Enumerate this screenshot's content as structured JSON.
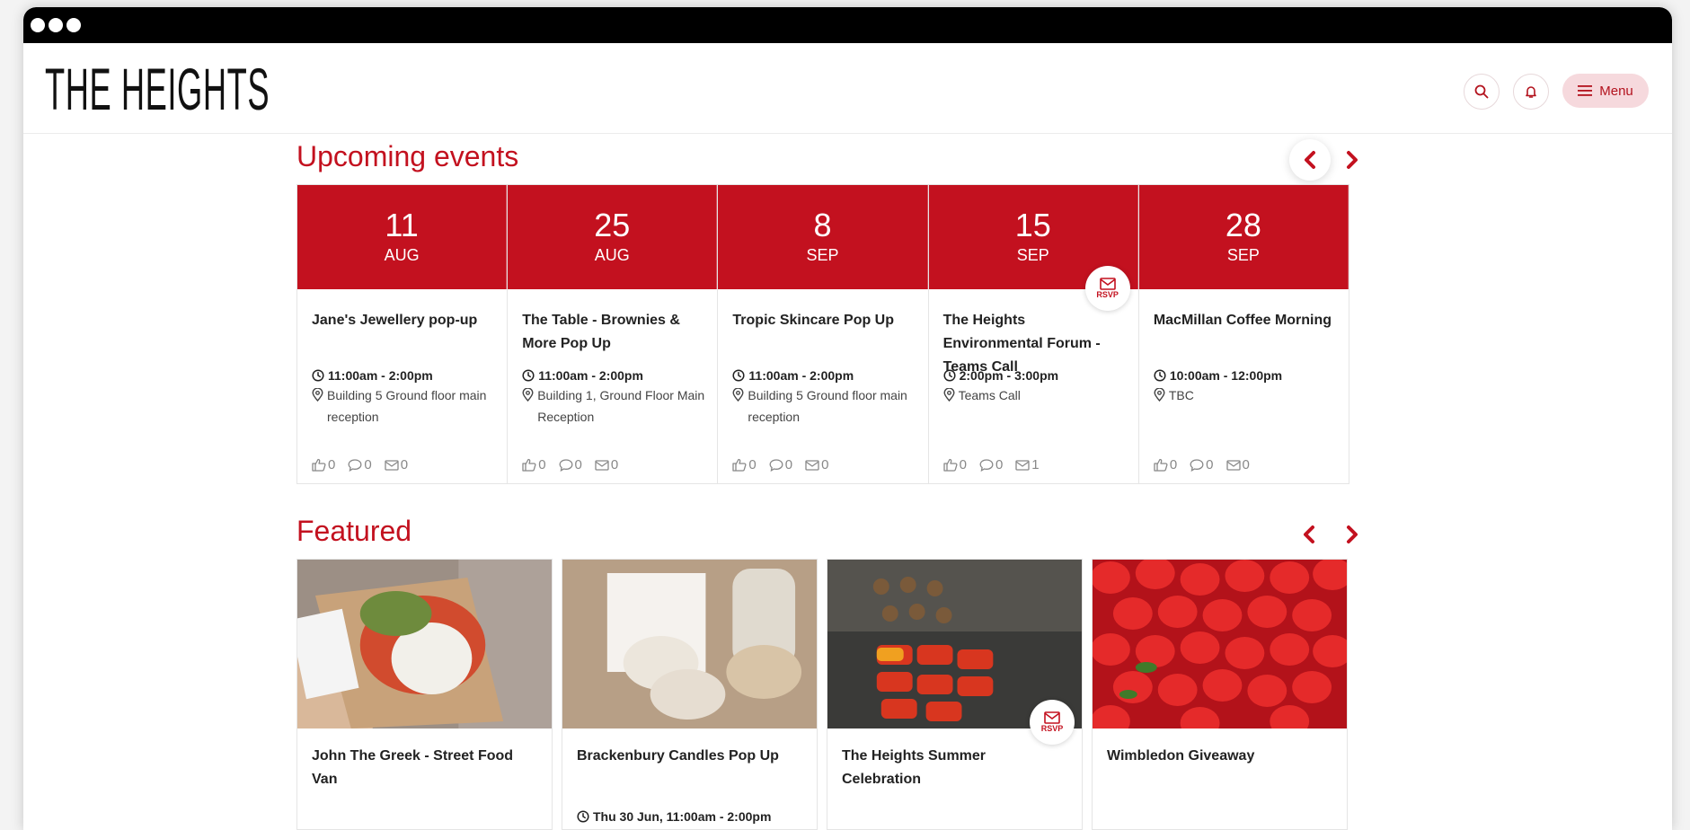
{
  "header": {
    "logo": "THE HEIGHTS",
    "menu_label": "Menu"
  },
  "upcoming": {
    "title": "Upcoming events",
    "events": [
      {
        "day": "11",
        "month": "AUG",
        "title": "Jane's Jewellery pop-up",
        "time": "11:00am - 2:00pm",
        "location": "Building 5 Ground floor main reception",
        "likes": "0",
        "comments": "0",
        "rsvps": "0",
        "rsvp_badge": false
      },
      {
        "day": "25",
        "month": "AUG",
        "title": "The Table - Brownies & More Pop Up",
        "time": "11:00am - 2:00pm",
        "location": "Building 1, Ground Floor Main Reception",
        "likes": "0",
        "comments": "0",
        "rsvps": "0",
        "rsvp_badge": false
      },
      {
        "day": "8",
        "month": "SEP",
        "title": "Tropic Skincare Pop Up",
        "time": "11:00am - 2:00pm",
        "location": "Building 5 Ground floor main reception",
        "likes": "0",
        "comments": "0",
        "rsvps": "0",
        "rsvp_badge": false
      },
      {
        "day": "15",
        "month": "SEP",
        "title": "The Heights Environmental Forum - Teams Call",
        "time": "2:00pm - 3:00pm",
        "location": "Teams Call",
        "likes": "0",
        "comments": "0",
        "rsvps": "1",
        "rsvp_badge": true
      },
      {
        "day": "28",
        "month": "SEP",
        "title": "MacMillan Coffee Morning",
        "time": "10:00am - 12:00pm",
        "location": "TBC",
        "likes": "0",
        "comments": "0",
        "rsvps": "0",
        "rsvp_badge": false
      }
    ]
  },
  "rsvp_label": "RSVP",
  "featured": {
    "title": "Featured",
    "cards": [
      {
        "title": "John The Greek - Street Food Van",
        "meta": ""
      },
      {
        "title": "Brackenbury Candles Pop Up",
        "meta": "Thu 30 Jun, 11:00am - 2:00pm"
      },
      {
        "title": "The Heights Summer Celebration",
        "meta": ""
      },
      {
        "title": "Wimbledon Giveaway",
        "meta": ""
      }
    ]
  },
  "colors": {
    "accent": "#c3111f",
    "menu_bg": "#f6d9dd"
  }
}
